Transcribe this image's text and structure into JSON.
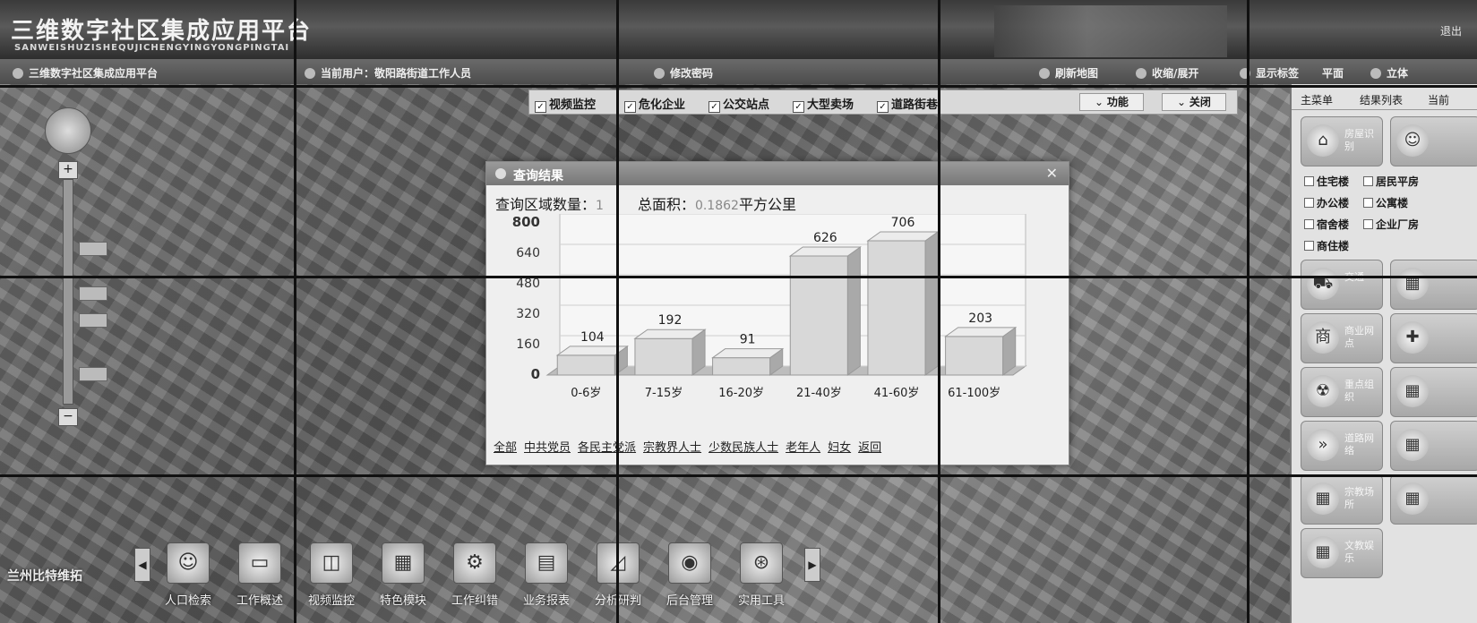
{
  "header": {
    "title": "三维数字社区集成应用平台",
    "subtitle": "SANWEISHUZISHEQUJICHENGYINGYONGPINGTAI",
    "logout": "退出"
  },
  "statusbar": {
    "breadcrumb": "三维数字社区集成应用平台",
    "current_user": "当前用户：敬阳路街道工作人员",
    "change_password": "修改密码",
    "refresh_map": "刷新地图",
    "collapse": "收缩/展开",
    "show_labels": "显示标签",
    "flat": "平面",
    "stereo": "立体"
  },
  "layers": {
    "items": [
      {
        "label": "视频监控",
        "checked": true
      },
      {
        "label": "危化企业",
        "checked": true
      },
      {
        "label": "公交站点",
        "checked": true
      },
      {
        "label": "大型卖场",
        "checked": true
      },
      {
        "label": "道路街巷",
        "checked": true
      }
    ],
    "function_btn": "功能",
    "close_btn": "关闭"
  },
  "dialog": {
    "title": "查询结果",
    "region_count_label": "查询区域数量：",
    "region_count_value": "1",
    "area_label": "总面积：",
    "area_value": "0.1862",
    "area_unit": "平方公里",
    "links": [
      "全部",
      "中共党员",
      "各民主党派",
      "宗教界人士",
      "少数民族人士",
      "老年人",
      "妇女",
      "返回"
    ]
  },
  "chart_data": {
    "type": "bar",
    "categories": [
      "0-6岁",
      "7-15岁",
      "16-20岁",
      "21-40岁",
      "41-60岁",
      "61-100岁"
    ],
    "values": [
      104,
      192,
      91,
      626,
      706,
      203
    ],
    "ylim": [
      0,
      800
    ],
    "yticks": [
      0,
      160,
      320,
      480,
      640,
      800
    ],
    "grid": true,
    "title": "",
    "xlabel": "",
    "ylabel": ""
  },
  "dock": {
    "items": [
      {
        "label": "人口检索",
        "icon": "people-icon"
      },
      {
        "label": "工作概述",
        "icon": "monitor-icon"
      },
      {
        "label": "视频监控",
        "icon": "camera-icon"
      },
      {
        "label": "特色模块",
        "icon": "grid-icon"
      },
      {
        "label": "工作纠错",
        "icon": "gear-icon"
      },
      {
        "label": "业务报表",
        "icon": "report-icon"
      },
      {
        "label": "分析研判",
        "icon": "analysis-icon"
      },
      {
        "label": "后台管理",
        "icon": "admin-icon"
      },
      {
        "label": "实用工具",
        "icon": "tools-icon"
      }
    ]
  },
  "logo": "兰州比特维拓",
  "panel": {
    "tabs": [
      "主菜单",
      "结果列表",
      "当前"
    ],
    "top_button": "房屋识别",
    "building_types": [
      "住宅楼",
      "居民平房",
      "办公楼",
      "公寓楼",
      "宿舍楼",
      "企业厂房",
      "商住楼"
    ],
    "buttons": [
      "交通",
      "商业网点",
      "重点组织",
      "道路网络",
      "宗教场所",
      "文教娱乐"
    ]
  },
  "colors": {
    "bar_face": "#d8d8d8",
    "bar_side": "#a9a9a9",
    "bar_top": "#ececec",
    "dialog_bg": "#efefef"
  }
}
